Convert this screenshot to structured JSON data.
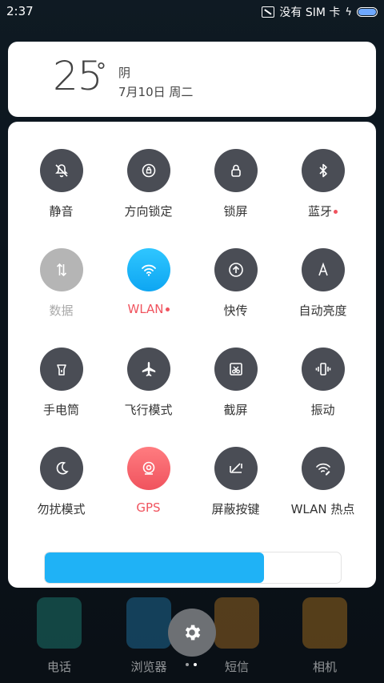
{
  "status_bar": {
    "time": "2:37",
    "carrier": "没有 SIM 卡"
  },
  "weather": {
    "temperature": "25",
    "degree_symbol": "°",
    "condition": "阴",
    "date": "7月10日 周二"
  },
  "toggles": [
    {
      "label": "静音",
      "icon": "mute-icon",
      "state": "off"
    },
    {
      "label": "方向锁定",
      "icon": "rotation-lock-icon",
      "state": "off"
    },
    {
      "label": "锁屏",
      "icon": "lock-icon",
      "state": "off"
    },
    {
      "label": "蓝牙",
      "icon": "bluetooth-icon",
      "state": "off",
      "dot": true
    },
    {
      "label": "数据",
      "icon": "data-icon",
      "state": "disabled"
    },
    {
      "label": "WLAN",
      "icon": "wifi-icon",
      "state": "on",
      "dot": true
    },
    {
      "label": "快传",
      "icon": "quick-transfer-icon",
      "state": "off"
    },
    {
      "label": "自动亮度",
      "icon": "auto-brightness-icon",
      "state": "off"
    },
    {
      "label": "手电筒",
      "icon": "flashlight-icon",
      "state": "off"
    },
    {
      "label": "飞行模式",
      "icon": "airplane-icon",
      "state": "off"
    },
    {
      "label": "截屏",
      "icon": "screenshot-icon",
      "state": "off"
    },
    {
      "label": "振动",
      "icon": "vibrate-icon",
      "state": "off"
    },
    {
      "label": "勿扰模式",
      "icon": "do-not-disturb-icon",
      "state": "off"
    },
    {
      "label": "GPS",
      "icon": "gps-icon",
      "state": "active-red"
    },
    {
      "label": "屏蔽按键",
      "icon": "block-keys-icon",
      "state": "off"
    },
    {
      "label": "WLAN 热点",
      "icon": "hotspot-icon",
      "state": "off"
    }
  ],
  "brightness": {
    "level": 0.74
  },
  "dock": [
    {
      "label": "电话",
      "icon": "phone-icon",
      "color": "#29b6a4"
    },
    {
      "label": "浏览器",
      "icon": "browser-icon",
      "color": "#2aa6e8"
    },
    {
      "label": "短信",
      "icon": "messages-icon",
      "color": "#f39c29"
    },
    {
      "label": "相机",
      "icon": "camera-icon",
      "color": "#f6a023"
    }
  ],
  "colors": {
    "toggle_off": "#4a4d55",
    "toggle_on": "#1fb2f6",
    "gps": "#f0535e",
    "brightness": "#1fb2f6"
  }
}
